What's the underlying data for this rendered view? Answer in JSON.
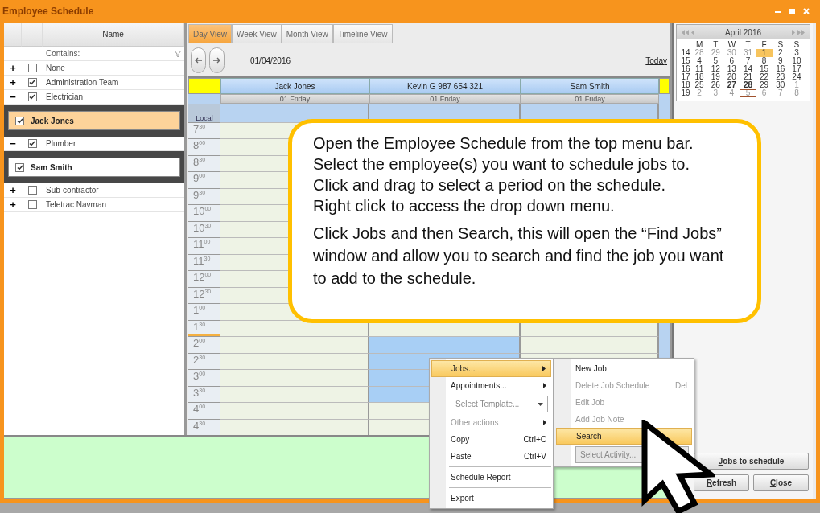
{
  "window": {
    "title": "Employee Schedule"
  },
  "tree": {
    "column": "Name",
    "filter_placeholder": "Contains:",
    "groups": [
      {
        "sign": "+",
        "label": "None",
        "checked": false
      },
      {
        "sign": "+",
        "label": "Administration Team",
        "checked": true
      },
      {
        "sign": "−",
        "label": "Electrician",
        "checked": true,
        "children": [
          {
            "label": "Jack Jones",
            "checked": true,
            "selected": true
          }
        ]
      },
      {
        "sign": "−",
        "label": "Plumber",
        "checked": true,
        "children": [
          {
            "label": "Sam Smith",
            "checked": true,
            "selected": false
          }
        ]
      },
      {
        "sign": "+",
        "label": "Sub-contractor",
        "checked": false
      },
      {
        "sign": "+",
        "label": "Teletrac Navman",
        "checked": false
      }
    ]
  },
  "tabs": [
    {
      "label": "Day View",
      "selected": true
    },
    {
      "label": "Week View",
      "selected": false
    },
    {
      "label": "Month View",
      "selected": false
    },
    {
      "label": "Timeline View",
      "selected": false
    }
  ],
  "date": "01/04/2016",
  "today_link": "Today",
  "schedule": {
    "time_label": "Local",
    "resources": [
      {
        "name": "Jack Jones",
        "date": "01 Friday"
      },
      {
        "name": "Kevin G 987 654 321",
        "date": "01 Friday"
      },
      {
        "name": "Sam Smith",
        "date": "01 Friday"
      }
    ],
    "slots": [
      {
        "time": "7$^{30}$",
        "now": false
      },
      {
        "time": "8$^{00}$",
        "now": false
      },
      {
        "time": "8$^{30}$",
        "now": false
      },
      {
        "time": "9$^{00}$",
        "now": false
      },
      {
        "time": "9$^{30}$",
        "now": false
      },
      {
        "time": "10$^{00}$",
        "now": false
      },
      {
        "time": "10$^{30}$",
        "now": false
      },
      {
        "time": "11$^{00}$",
        "now": false
      },
      {
        "time": "11$^{30}$",
        "now": false
      },
      {
        "time": "12$^{00}$",
        "now": false
      },
      {
        "time": "12$^{30}$",
        "now": false
      },
      {
        "time": "1$^{00}$",
        "now": false
      },
      {
        "time": "1$^{30}$",
        "now": true,
        "booked": [
          false,
          false,
          false
        ]
      },
      {
        "time": "2$^{00}$",
        "now": false,
        "booked": [
          false,
          true,
          false
        ]
      },
      {
        "time": "2$^{30}$",
        "now": false,
        "booked": [
          false,
          true,
          false
        ]
      },
      {
        "time": "3$^{00}$",
        "now": false,
        "booked": [
          false,
          true,
          false
        ]
      },
      {
        "time": "3$^{30}$",
        "now": false,
        "booked": [
          false,
          true,
          false
        ]
      },
      {
        "time": "4$^{00}$",
        "now": false
      },
      {
        "time": "4$^{30}$",
        "now": false
      }
    ]
  },
  "calendar": {
    "month": "April 2016",
    "weekdays": [
      "M",
      "T",
      "W",
      "T",
      "F",
      "S",
      "S"
    ],
    "weeks": [
      {
        "week": "14",
        "days": [
          {
            "d": "28",
            "other": true,
            "selected": false,
            "today": false,
            "busy": false
          },
          {
            "d": "29",
            "other": true,
            "selected": false,
            "today": false,
            "busy": false
          },
          {
            "d": "30",
            "other": true,
            "selected": false,
            "today": false,
            "busy": false
          },
          {
            "d": "31",
            "other": true,
            "selected": false,
            "today": false,
            "busy": false
          },
          {
            "d": "1",
            "other": false,
            "selected": true,
            "today": false,
            "busy": false
          },
          {
            "d": "2",
            "other": false,
            "selected": false,
            "today": false,
            "busy": false
          },
          {
            "d": "3",
            "other": false,
            "selected": false,
            "today": false,
            "busy": false
          }
        ]
      },
      {
        "week": "15",
        "days": [
          {
            "d": "4",
            "other": false,
            "selected": false,
            "today": false,
            "busy": false
          },
          {
            "d": "5",
            "other": false,
            "selected": false,
            "today": false,
            "busy": false
          },
          {
            "d": "6",
            "other": false,
            "selected": false,
            "today": false,
            "busy": false
          },
          {
            "d": "7",
            "other": false,
            "selected": false,
            "today": false,
            "busy": false
          },
          {
            "d": "8",
            "other": false,
            "selected": false,
            "today": false,
            "busy": false
          },
          {
            "d": "9",
            "other": false,
            "selected": false,
            "today": false,
            "busy": false
          },
          {
            "d": "10",
            "other": false,
            "selected": false,
            "today": false,
            "busy": false
          }
        ]
      },
      {
        "week": "16",
        "days": [
          {
            "d": "11",
            "other": false,
            "selected": false,
            "today": false,
            "busy": false
          },
          {
            "d": "12",
            "other": false,
            "selected": false,
            "today": false,
            "busy": false
          },
          {
            "d": "13",
            "other": false,
            "selected": false,
            "today": false,
            "busy": false
          },
          {
            "d": "14",
            "other": false,
            "selected": false,
            "today": false,
            "busy": false
          },
          {
            "d": "15",
            "other": false,
            "selected": false,
            "today": false,
            "busy": false
          },
          {
            "d": "16",
            "other": false,
            "selected": false,
            "today": false,
            "busy": false
          },
          {
            "d": "17",
            "other": false,
            "selected": false,
            "today": false,
            "busy": false
          }
        ]
      },
      {
        "week": "17",
        "days": [
          {
            "d": "18",
            "other": false,
            "selected": false,
            "today": false,
            "busy": false
          },
          {
            "d": "19",
            "other": false,
            "selected": false,
            "today": false,
            "busy": false
          },
          {
            "d": "20",
            "other": false,
            "selected": false,
            "today": false,
            "busy": false
          },
          {
            "d": "21",
            "other": false,
            "selected": false,
            "today": false,
            "busy": false
          },
          {
            "d": "22",
            "other": false,
            "selected": false,
            "today": false,
            "busy": false
          },
          {
            "d": "23",
            "other": false,
            "selected": false,
            "today": false,
            "busy": false
          },
          {
            "d": "24",
            "other": false,
            "selected": false,
            "today": false,
            "busy": false
          }
        ]
      },
      {
        "week": "18",
        "days": [
          {
            "d": "25",
            "other": false,
            "selected": false,
            "today": false,
            "busy": false
          },
          {
            "d": "26",
            "other": false,
            "selected": false,
            "today": false,
            "busy": false
          },
          {
            "d": "27",
            "other": false,
            "selected": false,
            "today": false,
            "busy": true
          },
          {
            "d": "28",
            "other": false,
            "selected": false,
            "today": false,
            "busy": true
          },
          {
            "d": "29",
            "other": false,
            "selected": false,
            "today": false,
            "busy": false
          },
          {
            "d": "30",
            "other": false,
            "selected": false,
            "today": false,
            "busy": false
          },
          {
            "d": "1",
            "other": true,
            "selected": false,
            "today": false,
            "busy": false
          }
        ]
      },
      {
        "week": "19",
        "days": [
          {
            "d": "2",
            "other": true,
            "selected": false,
            "today": false,
            "busy": false
          },
          {
            "d": "3",
            "other": true,
            "selected": false,
            "today": false,
            "busy": false
          },
          {
            "d": "4",
            "other": true,
            "selected": false,
            "today": false,
            "busy": false
          },
          {
            "d": "5",
            "other": true,
            "selected": false,
            "today": true,
            "busy": false
          },
          {
            "d": "6",
            "other": true,
            "selected": false,
            "today": false,
            "busy": false
          },
          {
            "d": "7",
            "other": true,
            "selected": false,
            "today": false,
            "busy": false
          },
          {
            "d": "8",
            "other": true,
            "selected": false,
            "today": false,
            "busy": false
          }
        ]
      }
    ]
  },
  "buttons": {
    "jobs": "Jobs to schedule",
    "refresh": "Refresh",
    "close": "Close"
  },
  "callout": {
    "lines": [
      "Open the Employee Schedule from the top menu bar.",
      "Select the employee(s) you want to schedule jobs to.",
      "Click and drag to select a period on the schedule.",
      "Right click to access the drop down menu."
    ],
    "paragraph": "Click Jobs and then Search, this will open the “Find Jobs” window and allow you to search and find the job you want to add to the schedule."
  },
  "context_menu": [
    {
      "kind": "item",
      "label": "Jobs...",
      "highlighted": true,
      "disabled": false,
      "submenu": true
    },
    {
      "kind": "item",
      "label": "Appointments...",
      "highlighted": false,
      "disabled": false,
      "submenu": true
    },
    {
      "kind": "select",
      "placeholder": "Select Template..."
    },
    {
      "kind": "item",
      "label": "Other actions",
      "highlighted": false,
      "disabled": true,
      "submenu": true
    },
    {
      "kind": "item",
      "label": "Copy",
      "shortcut": "Ctrl+C",
      "highlighted": false,
      "disabled": false,
      "submenu": false
    },
    {
      "kind": "item",
      "label": "Paste",
      "shortcut": "Ctrl+V",
      "highlighted": false,
      "disabled": false,
      "submenu": false
    },
    {
      "kind": "separator"
    },
    {
      "kind": "item",
      "label": "Schedule Report",
      "highlighted": false,
      "disabled": false,
      "submenu": false
    },
    {
      "kind": "separator"
    },
    {
      "kind": "item",
      "label": "Export",
      "highlighted": false,
      "disabled": false,
      "submenu": false
    }
  ],
  "submenu": [
    {
      "kind": "item",
      "label": "New Job",
      "highlighted": false,
      "disabled": false,
      "submenu": false
    },
    {
      "kind": "item",
      "label": "Delete Job Schedule",
      "shortcut": "Del",
      "highlighted": false,
      "disabled": true,
      "submenu": false
    },
    {
      "kind": "item",
      "label": "Edit Job",
      "highlighted": false,
      "disabled": true,
      "submenu": false
    },
    {
      "kind": "item",
      "label": "Add Job Note",
      "highlighted": false,
      "disabled": true,
      "submenu": false
    },
    {
      "kind": "item",
      "label": "Search",
      "highlighted": true,
      "disabled": false,
      "submenu": false
    },
    {
      "kind": "select",
      "placeholder": "Select Activity...",
      "disabled": true
    }
  ]
}
